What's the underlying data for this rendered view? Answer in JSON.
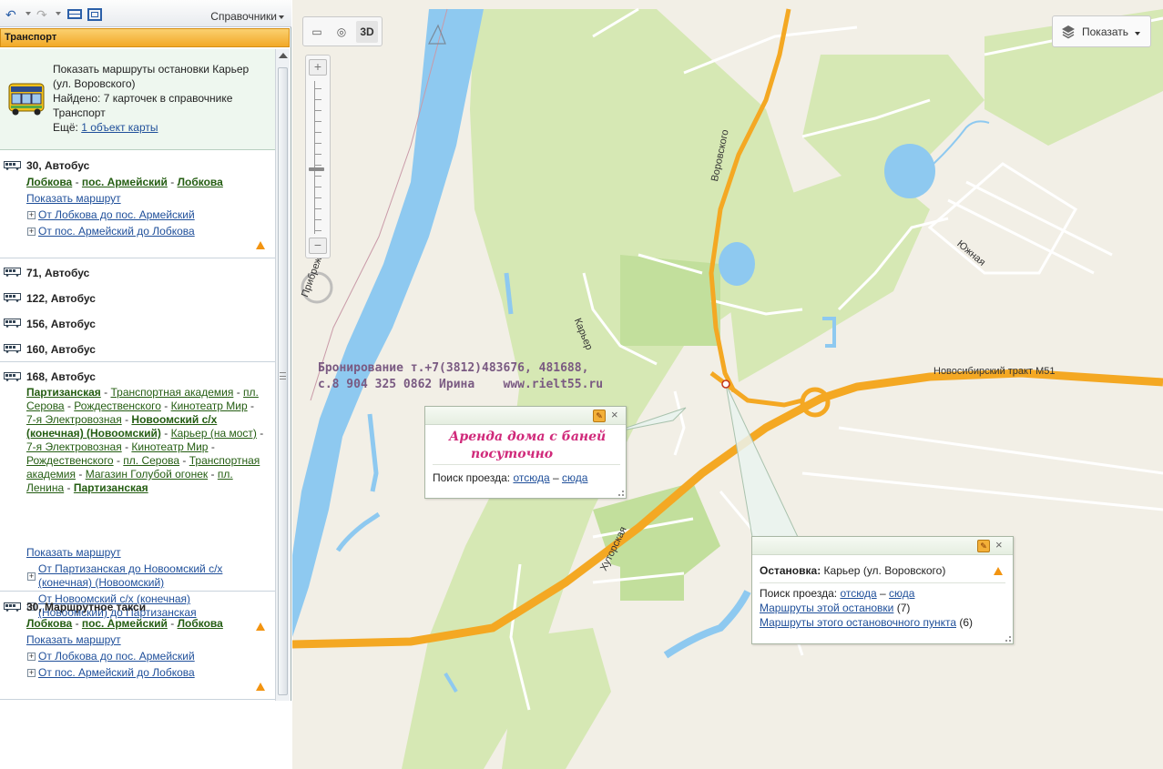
{
  "toolbar": {
    "reference_menu": "Справочники"
  },
  "section": {
    "title": "Транспорт"
  },
  "info": {
    "line1": "Показать маршруты остановки Карьер",
    "line2": "(ул. Воровского)",
    "line3": "Найдено: 7 карточек в справочнике",
    "line4": "Транспорт",
    "more_label": "Ещё:",
    "more_link": "1 объект карты"
  },
  "routes": {
    "r1": {
      "title": "30, Автобус",
      "stops": [
        "Лобкова",
        "пос. Армейский",
        "Лобкова"
      ],
      "show_route": "Показать маршрут",
      "dir1": "От Лобкова до пос. Армейский",
      "dir2": "От пос. Армейский до Лобкова"
    },
    "r2": {
      "title": "71, Автобус"
    },
    "r3": {
      "title": "122, Автобус"
    },
    "r4": {
      "title": "156, Автобус"
    },
    "r5": {
      "title": "160, Автобус"
    },
    "r6": {
      "title": "168, Автобус",
      "stops": [
        {
          "t": "Партизанская",
          "b": true
        },
        {
          "t": "Транспортная академия",
          "b": false
        },
        {
          "t": "пл. Серова",
          "b": false
        },
        {
          "t": "Рождественского",
          "b": false
        },
        {
          "t": "Кинотеатр Мир",
          "b": false
        },
        {
          "t": "7-я Электровозная",
          "b": false
        },
        {
          "t": "Новоомский с/х (конечная) (Новоомский)",
          "b": true
        },
        {
          "t": "Карьер (на мост)",
          "b": false
        },
        {
          "t": "7-я Электровозная",
          "b": false
        },
        {
          "t": "Кинотеатр Мир",
          "b": false
        },
        {
          "t": "Рождественского",
          "b": false
        },
        {
          "t": "пл. Серова",
          "b": false
        },
        {
          "t": "Транспортная академия",
          "b": false
        },
        {
          "t": "Магазин Голубой огонек",
          "b": false
        },
        {
          "t": "пл. Ленина",
          "b": false
        },
        {
          "t": "Партизанская",
          "b": true
        }
      ],
      "show_route": "Показать маршрут",
      "dir1a": "От Партизанская до Новоомский с/х",
      "dir1b": "(конечная) (Новоомский)",
      "dir2a": "От Новоомский с/х (конечная)",
      "dir2b": "(Новоомский) до Партизанская"
    },
    "r7": {
      "title": "30, Маршрутное такси",
      "stops": [
        "Лобкова",
        "пос. Армейский",
        "Лобкова"
      ],
      "show_route": "Показать маршрут",
      "dir1": "От Лобкова до пос. Армейский",
      "dir2": "От пос. Армейский до Лобкова"
    }
  },
  "map": {
    "btn_3d": "3D",
    "show_button": "Показать",
    "streets": {
      "vorovskogo": "Воровского",
      "karer": "Карьер",
      "yuzhnaya": "Южная",
      "khutorskaya": "Хуторская",
      "trakt": "Новосибирский тракт М51",
      "pribrezhnaya": "Прибреж"
    },
    "ad_line1": "Бронирование т.+7(3812)483676, 481688,",
    "ad_line2": "с.8 904 325 0862 Ирина    www.rielt55.ru",
    "popup_house": {
      "title_line1": "Аренда дома с баней",
      "title_line2": "посуточно",
      "route_label": "Поиск проезда:",
      "from": "отсюда",
      "dash": "–",
      "to": "сюда"
    },
    "popup_stop": {
      "label": "Остановка:",
      "name": "Карьер (ул. Воровского)",
      "route_label": "Поиск проезда:",
      "from": "отсюда",
      "dash": "–",
      "to": "сюда",
      "link1": "Маршруты этой остановки",
      "count1": "(7)",
      "link2": "Маршруты этого остановочного пункта",
      "count2": "(6)"
    }
  },
  "colors": {
    "accent_orange": "#f2a927",
    "road_main": "#f4a823",
    "water": "#8ec9f0",
    "greenery": "#d6e8b4",
    "link_blue": "#1f4f9a",
    "link_green": "#245d12"
  }
}
